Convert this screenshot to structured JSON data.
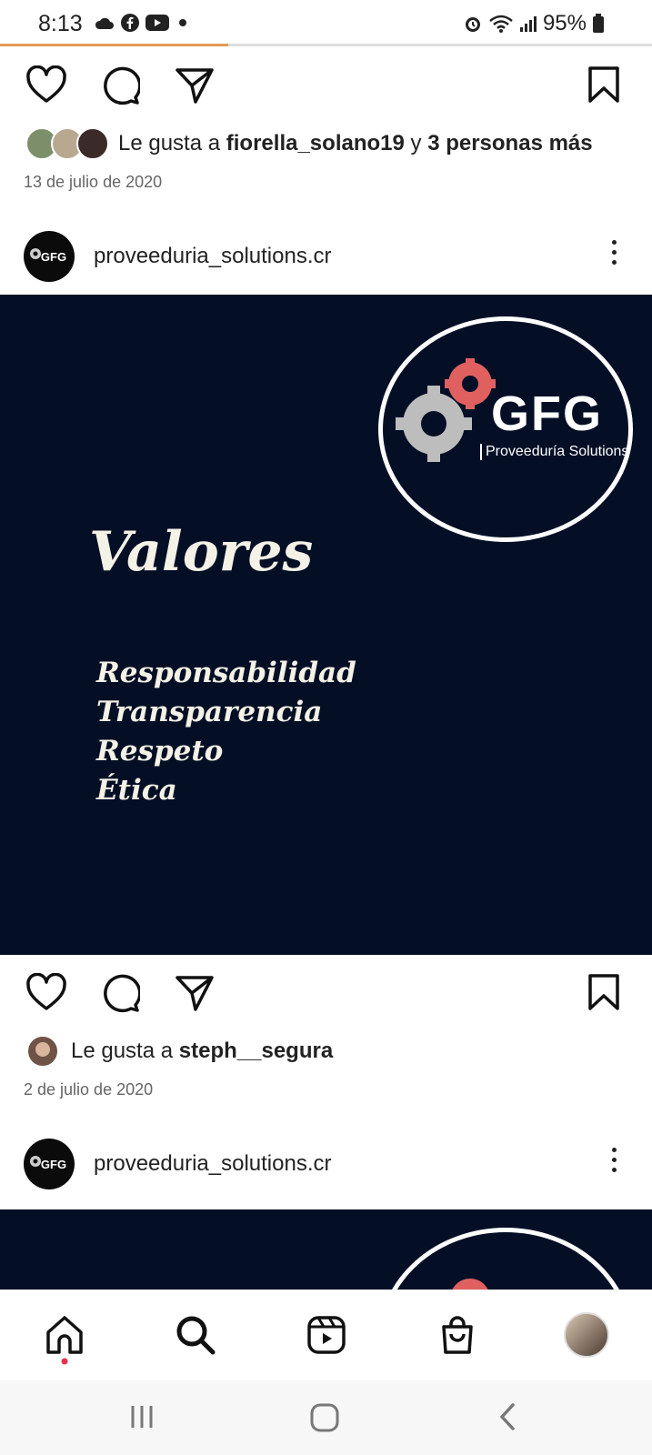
{
  "status_bar": {
    "time": "8:13",
    "battery": "95%",
    "icons": [
      "cloud-icon",
      "facebook-icon",
      "youtube-icon",
      "dot-icon",
      "alarm-icon",
      "wifi-icon",
      "signal-icon",
      "battery-icon"
    ]
  },
  "story_progress": 0.35,
  "post1_footer": {
    "likes_prefix": "Le gusta a ",
    "liked_user": "fiorella_solano19",
    "likes_conj": " y ",
    "likes_others": "3 personas más",
    "date": "13 de julio de 2020"
  },
  "post2": {
    "username": "proveeduria_solutions.cr",
    "avatar_text": "GFG",
    "image": {
      "logo_text": "GFG",
      "logo_subtitle": "Proveeduría Solutions",
      "title": "Valores",
      "values": [
        "Responsabilidad",
        "Transparencia",
        "Respeto",
        "Ética"
      ]
    },
    "likes_prefix": "Le gusta a ",
    "liked_user": "steph__segura",
    "date": "2 de julio de 2020"
  },
  "post3": {
    "username": "proveeduria_solutions.cr",
    "avatar_text": "GFG"
  },
  "colors": {
    "post_bg": "#040f26",
    "accent_progress": "#e39b55",
    "gear_red": "#e06060"
  },
  "bottom_nav": [
    "home-icon",
    "search-icon",
    "reels-icon",
    "shop-icon",
    "profile-avatar"
  ]
}
